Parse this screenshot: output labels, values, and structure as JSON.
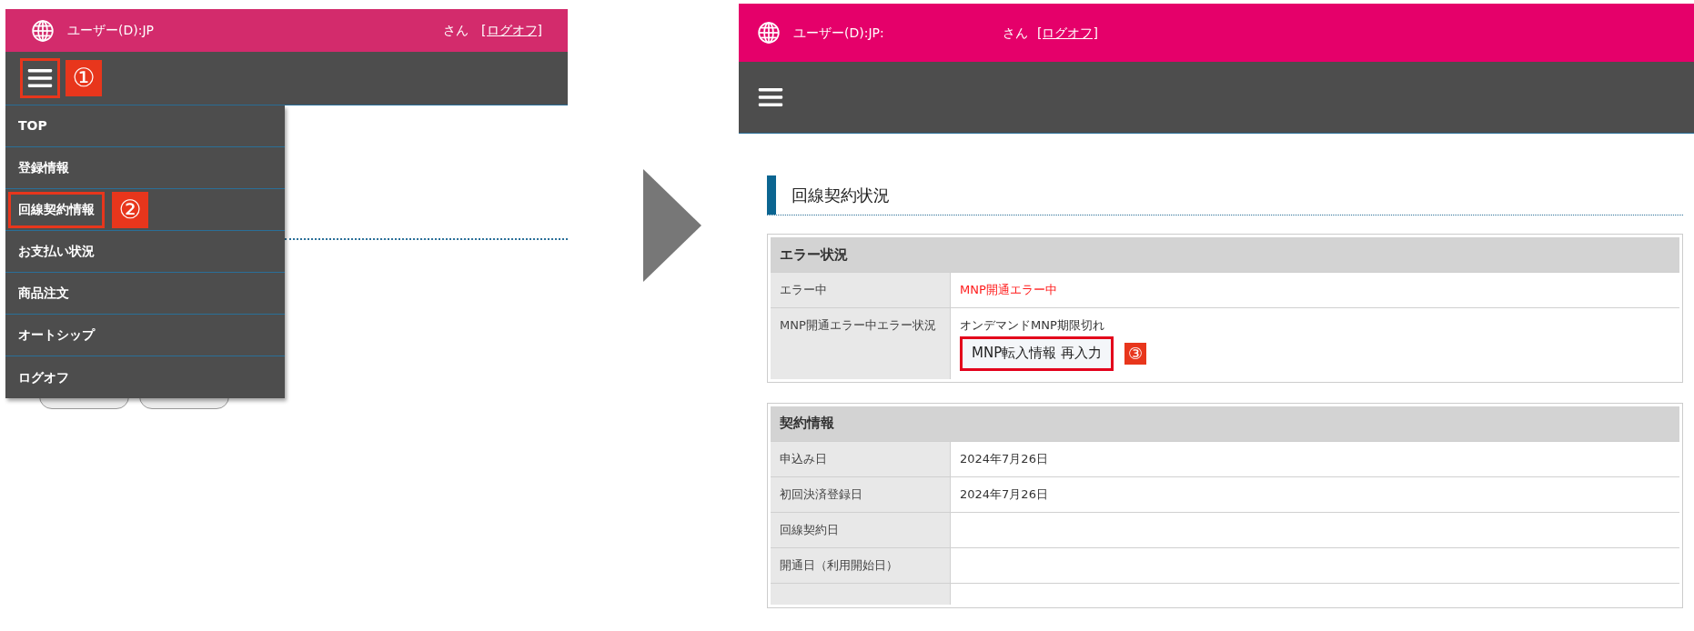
{
  "left_screen": {
    "header": {
      "user": "ユーザー(D):JP",
      "honorific": "さん",
      "logoff": "[ログオフ]"
    },
    "menu_button": {
      "highlighted": true,
      "marker": "①"
    },
    "menu_items": [
      {
        "label": "TOP",
        "highlighted": false
      },
      {
        "label": "登録情報",
        "highlighted": false
      },
      {
        "label": "回線契約情報",
        "highlighted": true,
        "marker": "②"
      },
      {
        "label": "お支払い状況",
        "highlighted": false
      },
      {
        "label": "商品注文",
        "highlighted": false
      },
      {
        "label": "オートシップ",
        "highlighted": false
      },
      {
        "label": "ログオフ",
        "highlighted": false
      }
    ]
  },
  "right_screen": {
    "header": {
      "user": "ユーザー(D):JP:",
      "honorific": "さん",
      "logoff": "[ログオフ]"
    },
    "section_title": "回線契約状況",
    "tables": [
      {
        "title": "エラー状況",
        "rows": [
          {
            "kind": "error",
            "label": "エラー中",
            "value": "MNP開通エラー中"
          },
          {
            "kind": "action",
            "label": "MNP開通エラー中エラー状況",
            "value": "オンデマンドMNP期限切れ",
            "button": "MNP転入情報 再入力",
            "highlighted": true,
            "marker": "③"
          }
        ]
      },
      {
        "title": "契約情報",
        "rows": [
          {
            "kind": "text",
            "label": "申込み日",
            "value": "2024年7月26日"
          },
          {
            "kind": "text",
            "label": "初回決済登録日",
            "value": "2024年7月26日"
          },
          {
            "kind": "text",
            "label": "回線契約日"
          },
          {
            "kind": "text",
            "label": "開通日（利用開始日）"
          },
          {
            "kind": "partial"
          }
        ]
      }
    ]
  }
}
